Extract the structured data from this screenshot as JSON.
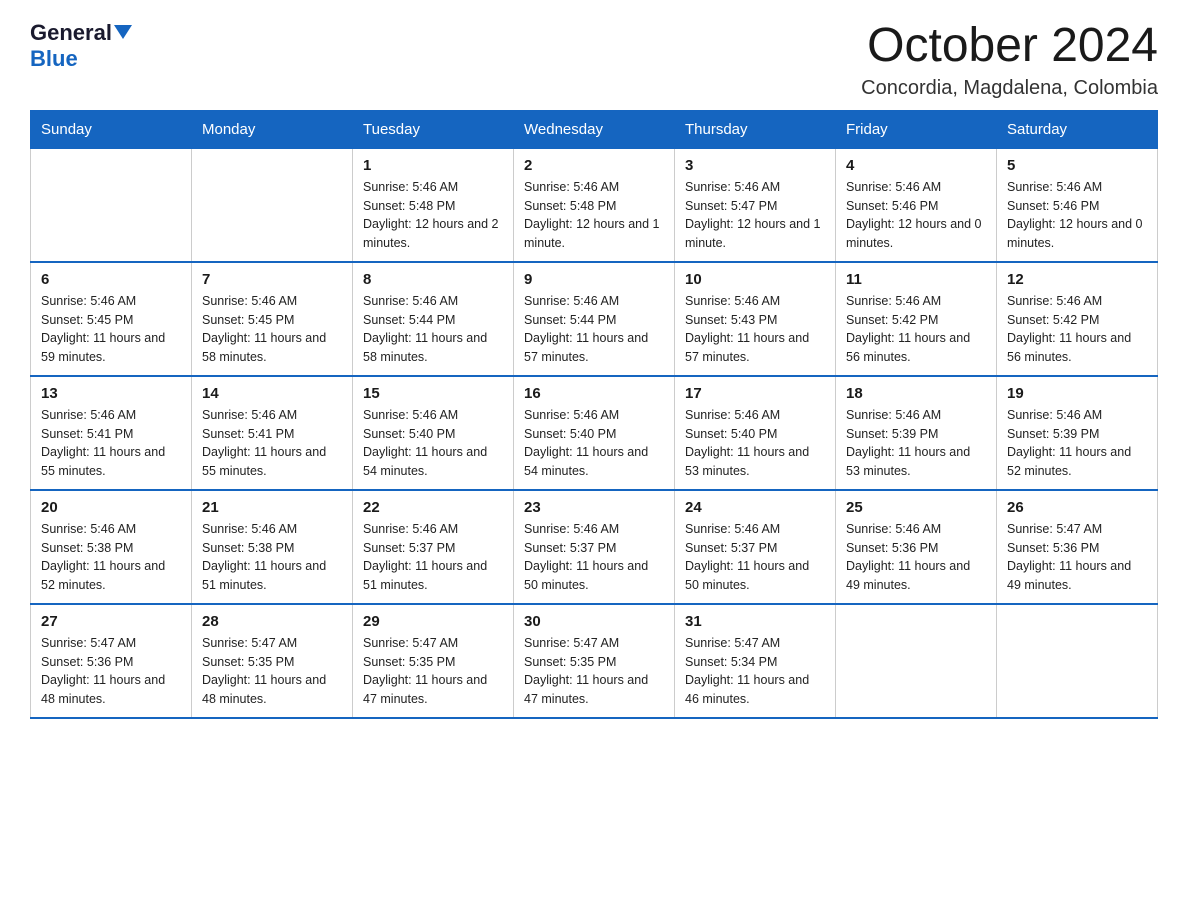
{
  "logo": {
    "general": "General",
    "blue": "Blue"
  },
  "title": "October 2024",
  "location": "Concordia, Magdalena, Colombia",
  "days_of_week": [
    "Sunday",
    "Monday",
    "Tuesday",
    "Wednesday",
    "Thursday",
    "Friday",
    "Saturday"
  ],
  "weeks": [
    [
      {
        "day": "",
        "sunrise": "",
        "sunset": "",
        "daylight": ""
      },
      {
        "day": "",
        "sunrise": "",
        "sunset": "",
        "daylight": ""
      },
      {
        "day": "1",
        "sunrise": "Sunrise: 5:46 AM",
        "sunset": "Sunset: 5:48 PM",
        "daylight": "Daylight: 12 hours and 2 minutes."
      },
      {
        "day": "2",
        "sunrise": "Sunrise: 5:46 AM",
        "sunset": "Sunset: 5:48 PM",
        "daylight": "Daylight: 12 hours and 1 minute."
      },
      {
        "day": "3",
        "sunrise": "Sunrise: 5:46 AM",
        "sunset": "Sunset: 5:47 PM",
        "daylight": "Daylight: 12 hours and 1 minute."
      },
      {
        "day": "4",
        "sunrise": "Sunrise: 5:46 AM",
        "sunset": "Sunset: 5:46 PM",
        "daylight": "Daylight: 12 hours and 0 minutes."
      },
      {
        "day": "5",
        "sunrise": "Sunrise: 5:46 AM",
        "sunset": "Sunset: 5:46 PM",
        "daylight": "Daylight: 12 hours and 0 minutes."
      }
    ],
    [
      {
        "day": "6",
        "sunrise": "Sunrise: 5:46 AM",
        "sunset": "Sunset: 5:45 PM",
        "daylight": "Daylight: 11 hours and 59 minutes."
      },
      {
        "day": "7",
        "sunrise": "Sunrise: 5:46 AM",
        "sunset": "Sunset: 5:45 PM",
        "daylight": "Daylight: 11 hours and 58 minutes."
      },
      {
        "day": "8",
        "sunrise": "Sunrise: 5:46 AM",
        "sunset": "Sunset: 5:44 PM",
        "daylight": "Daylight: 11 hours and 58 minutes."
      },
      {
        "day": "9",
        "sunrise": "Sunrise: 5:46 AM",
        "sunset": "Sunset: 5:44 PM",
        "daylight": "Daylight: 11 hours and 57 minutes."
      },
      {
        "day": "10",
        "sunrise": "Sunrise: 5:46 AM",
        "sunset": "Sunset: 5:43 PM",
        "daylight": "Daylight: 11 hours and 57 minutes."
      },
      {
        "day": "11",
        "sunrise": "Sunrise: 5:46 AM",
        "sunset": "Sunset: 5:42 PM",
        "daylight": "Daylight: 11 hours and 56 minutes."
      },
      {
        "day": "12",
        "sunrise": "Sunrise: 5:46 AM",
        "sunset": "Sunset: 5:42 PM",
        "daylight": "Daylight: 11 hours and 56 minutes."
      }
    ],
    [
      {
        "day": "13",
        "sunrise": "Sunrise: 5:46 AM",
        "sunset": "Sunset: 5:41 PM",
        "daylight": "Daylight: 11 hours and 55 minutes."
      },
      {
        "day": "14",
        "sunrise": "Sunrise: 5:46 AM",
        "sunset": "Sunset: 5:41 PM",
        "daylight": "Daylight: 11 hours and 55 minutes."
      },
      {
        "day": "15",
        "sunrise": "Sunrise: 5:46 AM",
        "sunset": "Sunset: 5:40 PM",
        "daylight": "Daylight: 11 hours and 54 minutes."
      },
      {
        "day": "16",
        "sunrise": "Sunrise: 5:46 AM",
        "sunset": "Sunset: 5:40 PM",
        "daylight": "Daylight: 11 hours and 54 minutes."
      },
      {
        "day": "17",
        "sunrise": "Sunrise: 5:46 AM",
        "sunset": "Sunset: 5:40 PM",
        "daylight": "Daylight: 11 hours and 53 minutes."
      },
      {
        "day": "18",
        "sunrise": "Sunrise: 5:46 AM",
        "sunset": "Sunset: 5:39 PM",
        "daylight": "Daylight: 11 hours and 53 minutes."
      },
      {
        "day": "19",
        "sunrise": "Sunrise: 5:46 AM",
        "sunset": "Sunset: 5:39 PM",
        "daylight": "Daylight: 11 hours and 52 minutes."
      }
    ],
    [
      {
        "day": "20",
        "sunrise": "Sunrise: 5:46 AM",
        "sunset": "Sunset: 5:38 PM",
        "daylight": "Daylight: 11 hours and 52 minutes."
      },
      {
        "day": "21",
        "sunrise": "Sunrise: 5:46 AM",
        "sunset": "Sunset: 5:38 PM",
        "daylight": "Daylight: 11 hours and 51 minutes."
      },
      {
        "day": "22",
        "sunrise": "Sunrise: 5:46 AM",
        "sunset": "Sunset: 5:37 PM",
        "daylight": "Daylight: 11 hours and 51 minutes."
      },
      {
        "day": "23",
        "sunrise": "Sunrise: 5:46 AM",
        "sunset": "Sunset: 5:37 PM",
        "daylight": "Daylight: 11 hours and 50 minutes."
      },
      {
        "day": "24",
        "sunrise": "Sunrise: 5:46 AM",
        "sunset": "Sunset: 5:37 PM",
        "daylight": "Daylight: 11 hours and 50 minutes."
      },
      {
        "day": "25",
        "sunrise": "Sunrise: 5:46 AM",
        "sunset": "Sunset: 5:36 PM",
        "daylight": "Daylight: 11 hours and 49 minutes."
      },
      {
        "day": "26",
        "sunrise": "Sunrise: 5:47 AM",
        "sunset": "Sunset: 5:36 PM",
        "daylight": "Daylight: 11 hours and 49 minutes."
      }
    ],
    [
      {
        "day": "27",
        "sunrise": "Sunrise: 5:47 AM",
        "sunset": "Sunset: 5:36 PM",
        "daylight": "Daylight: 11 hours and 48 minutes."
      },
      {
        "day": "28",
        "sunrise": "Sunrise: 5:47 AM",
        "sunset": "Sunset: 5:35 PM",
        "daylight": "Daylight: 11 hours and 48 minutes."
      },
      {
        "day": "29",
        "sunrise": "Sunrise: 5:47 AM",
        "sunset": "Sunset: 5:35 PM",
        "daylight": "Daylight: 11 hours and 47 minutes."
      },
      {
        "day": "30",
        "sunrise": "Sunrise: 5:47 AM",
        "sunset": "Sunset: 5:35 PM",
        "daylight": "Daylight: 11 hours and 47 minutes."
      },
      {
        "day": "31",
        "sunrise": "Sunrise: 5:47 AM",
        "sunset": "Sunset: 5:34 PM",
        "daylight": "Daylight: 11 hours and 46 minutes."
      },
      {
        "day": "",
        "sunrise": "",
        "sunset": "",
        "daylight": ""
      },
      {
        "day": "",
        "sunrise": "",
        "sunset": "",
        "daylight": ""
      }
    ]
  ]
}
